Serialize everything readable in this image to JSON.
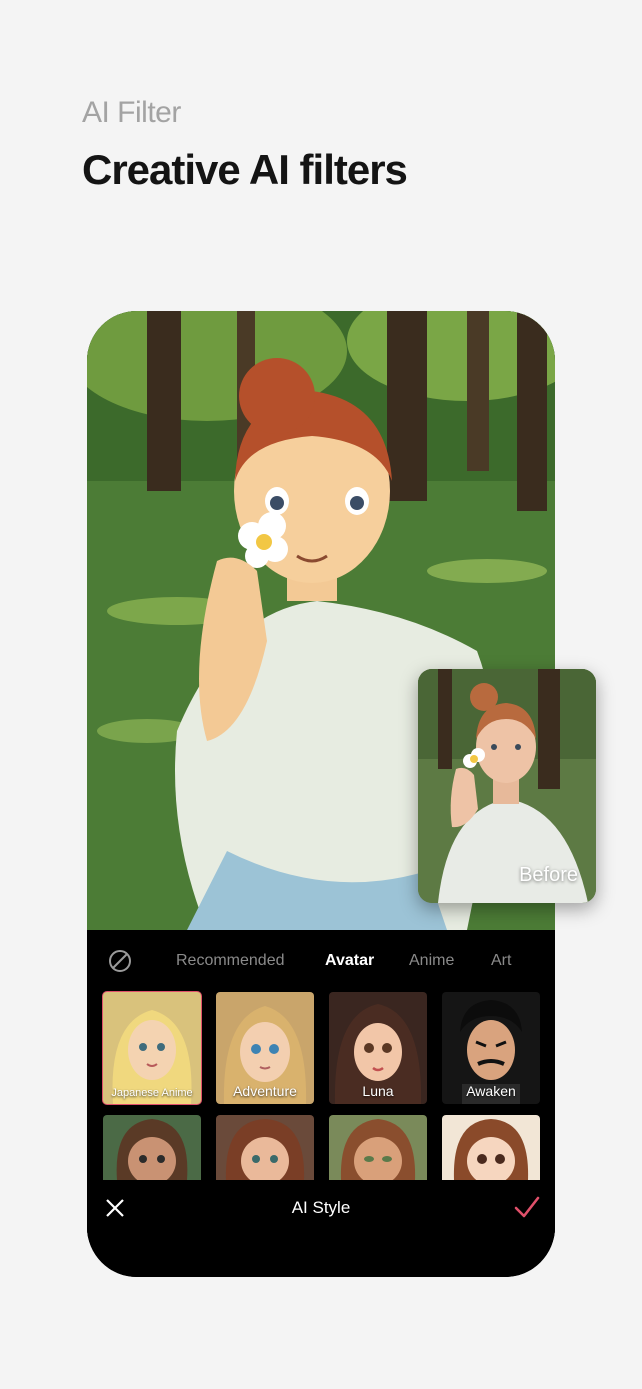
{
  "header": {
    "eyebrow": "AI Filter",
    "headline": "Creative AI filters"
  },
  "preview": {
    "before_label": "Before"
  },
  "tabs": {
    "none_icon": "no-filter-icon",
    "items": [
      "Recommended",
      "Avatar",
      "Anime",
      "Art"
    ],
    "active": "Avatar"
  },
  "styles": [
    {
      "label": "Japanese Anime",
      "selected": true
    },
    {
      "label": "Adventure",
      "selected": false
    },
    {
      "label": "Luna",
      "selected": false
    },
    {
      "label": "Awaken",
      "selected": false
    }
  ],
  "bottom_bar": {
    "close_icon": "close-icon",
    "title": "AI Style",
    "confirm_icon": "checkmark-icon"
  },
  "colors": {
    "background": "#f4f4f4",
    "accent": "#e0506a",
    "panel": "#000000"
  }
}
